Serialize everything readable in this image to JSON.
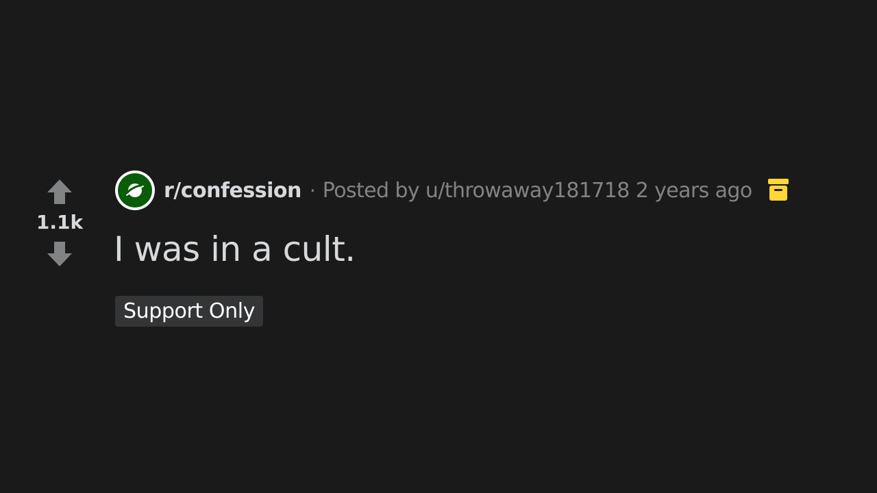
{
  "post": {
    "score": "1.1k",
    "subreddit": "r/confession",
    "separator": "·",
    "posted_by": "Posted by u/throwaway181718 2 years ago",
    "title": "I was in a cult.",
    "flair": "Support Only"
  },
  "icons": {
    "upvote": "upvote-arrow-icon",
    "downvote": "downvote-arrow-icon",
    "subreddit": "planet-icon",
    "archived": "archive-box-icon"
  },
  "colors": {
    "background": "#1a1a1b",
    "text": "#d7dadc",
    "muted": "#818384",
    "subreddit_icon_bg": "#0a5c0a",
    "archive_icon": "#ffd635",
    "flair_bg": "#343536"
  }
}
